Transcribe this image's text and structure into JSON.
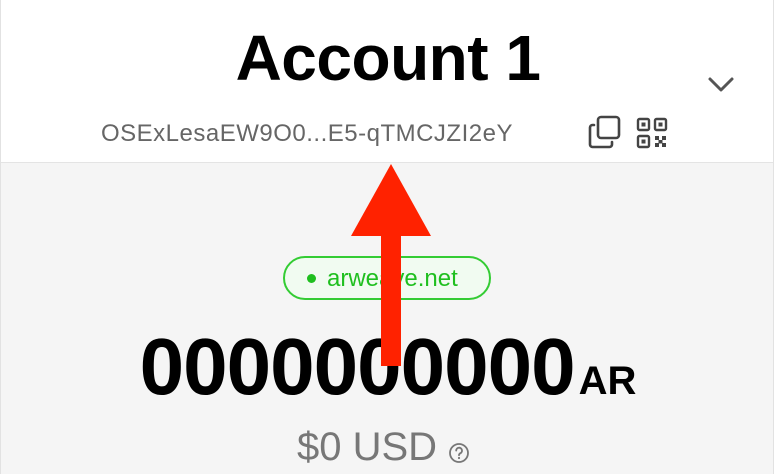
{
  "header": {
    "account_name": "Account 1",
    "address": "OSExLesaEW9O0...E5-qTMCJZI2eY"
  },
  "icons": {
    "chevron": "chevron-down-icon",
    "copy": "copy-icon",
    "qr": "qr-code-icon",
    "help": "question-icon"
  },
  "gateway": {
    "label": "arweave.net",
    "status_color": "#1fbf1f"
  },
  "balance": {
    "amount": "0000000000",
    "unit": "AR"
  },
  "fiat": {
    "amount": "$0 USD"
  },
  "colors": {
    "annotation_arrow": "#ff2200",
    "badge_border": "#33cc33"
  }
}
